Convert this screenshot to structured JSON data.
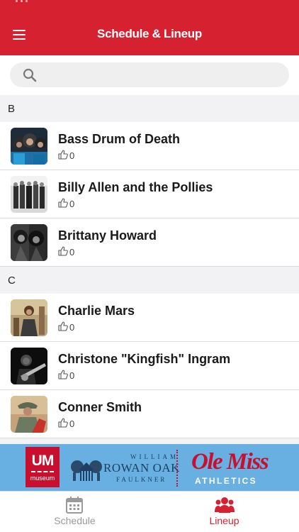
{
  "header": {
    "title": "Schedule & Lineup",
    "menu_icon": "menu-icon",
    "background": "#d62130"
  },
  "search": {
    "value": "",
    "placeholder": "",
    "icon": "search-icon"
  },
  "sections": [
    {
      "letter": "B",
      "artists": [
        {
          "name": "Bass Drum of Death",
          "likes": "0"
        },
        {
          "name": "Billy Allen and the Pollies",
          "likes": "0"
        },
        {
          "name": "Brittany Howard",
          "likes": "0"
        }
      ]
    },
    {
      "letter": "C",
      "artists": [
        {
          "name": "Charlie Mars",
          "likes": "0"
        },
        {
          "name": "Christone \"Kingfish\" Ingram",
          "likes": "0"
        },
        {
          "name": "Conner Smith",
          "likes": "0"
        }
      ]
    }
  ],
  "banner": {
    "um_logo": "UM",
    "um_sub": "museum",
    "rowan_top": "WILLIAM",
    "rowan_main": "ROWAN OAK",
    "rowan_bottom": "FAULKNER",
    "olemiss": "Ole Miss",
    "olemiss_sub": "ATHLETICS"
  },
  "tabbar": {
    "tabs": [
      {
        "label": "Schedule",
        "icon": "calendar-icon",
        "active": false
      },
      {
        "label": "Lineup",
        "icon": "group-icon",
        "active": true
      }
    ],
    "active_color": "#d62130",
    "inactive_color": "#9a9a9a"
  }
}
